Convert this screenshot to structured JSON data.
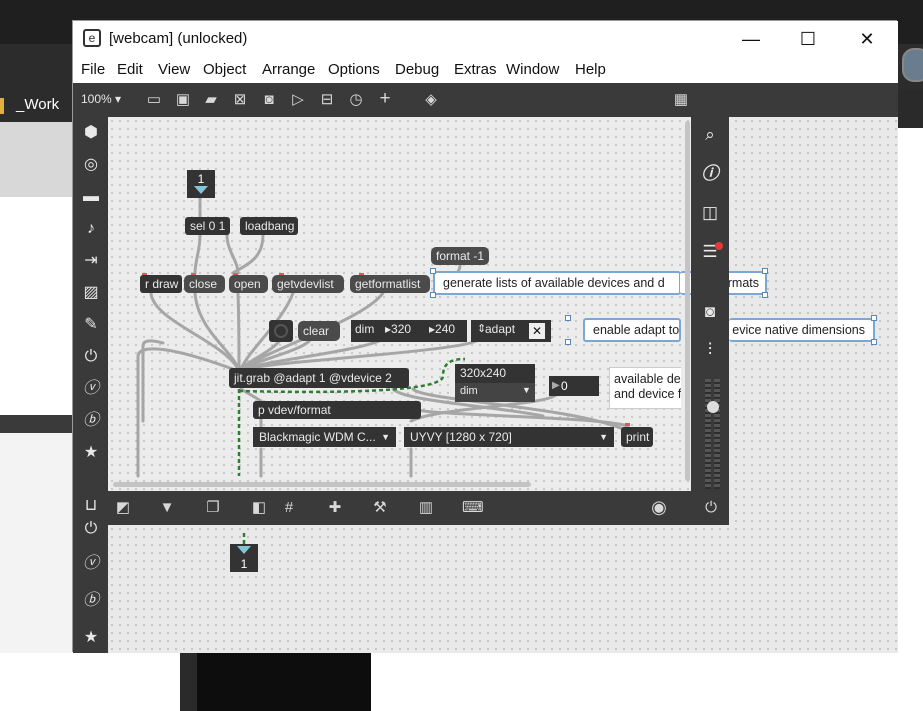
{
  "background": {
    "work_label": "_Work"
  },
  "window": {
    "title": "[webcam] (unlocked)",
    "minimize_glyph": "—",
    "maximize_glyph": "☐",
    "close_glyph": "✕"
  },
  "menubar": {
    "items": [
      "File",
      "Edit",
      "View",
      "Object",
      "Arrange",
      "Options",
      "Debug",
      "Extras",
      "Window",
      "Help"
    ]
  },
  "toolbar": {
    "zoom": "100%"
  },
  "patch": {
    "toggle_top": "1",
    "toggle_bottom": "1",
    "sel": "sel 0 1",
    "loadbang": "loadbang",
    "format": "format -1",
    "rdraw": "r draw",
    "close": "close",
    "open": "open",
    "getvdevlist": "getvdevlist",
    "getformatlist": "getformatlist",
    "comment1": "generate lists of available devices and d",
    "comment1_tail": "rmats",
    "clear": "clear",
    "dim": "dim",
    "dim_w": "320",
    "dim_h": "240",
    "adapt": "adapt",
    "comment2_head": "enable adapt to",
    "comment2_tail": "evice native dimensions",
    "jitgrab": "jit.grab @adapt 1 @vdevice 2",
    "res_label": "320x240",
    "res_select": "dim",
    "number": "0",
    "comment3_line1": "available de",
    "comment3_line2": "and device f",
    "pvdev": "p vdev/format",
    "device_menu": "Blackmagic WDM C...",
    "format_menu": "UYVY [1280 x 720]",
    "print": "print"
  },
  "colors": {
    "panel": "#3a3a3a",
    "object": "#333333",
    "accent": "#7aa7d6",
    "patchcord": "#a0a0a0",
    "signal_cord": "#2e7d32"
  }
}
